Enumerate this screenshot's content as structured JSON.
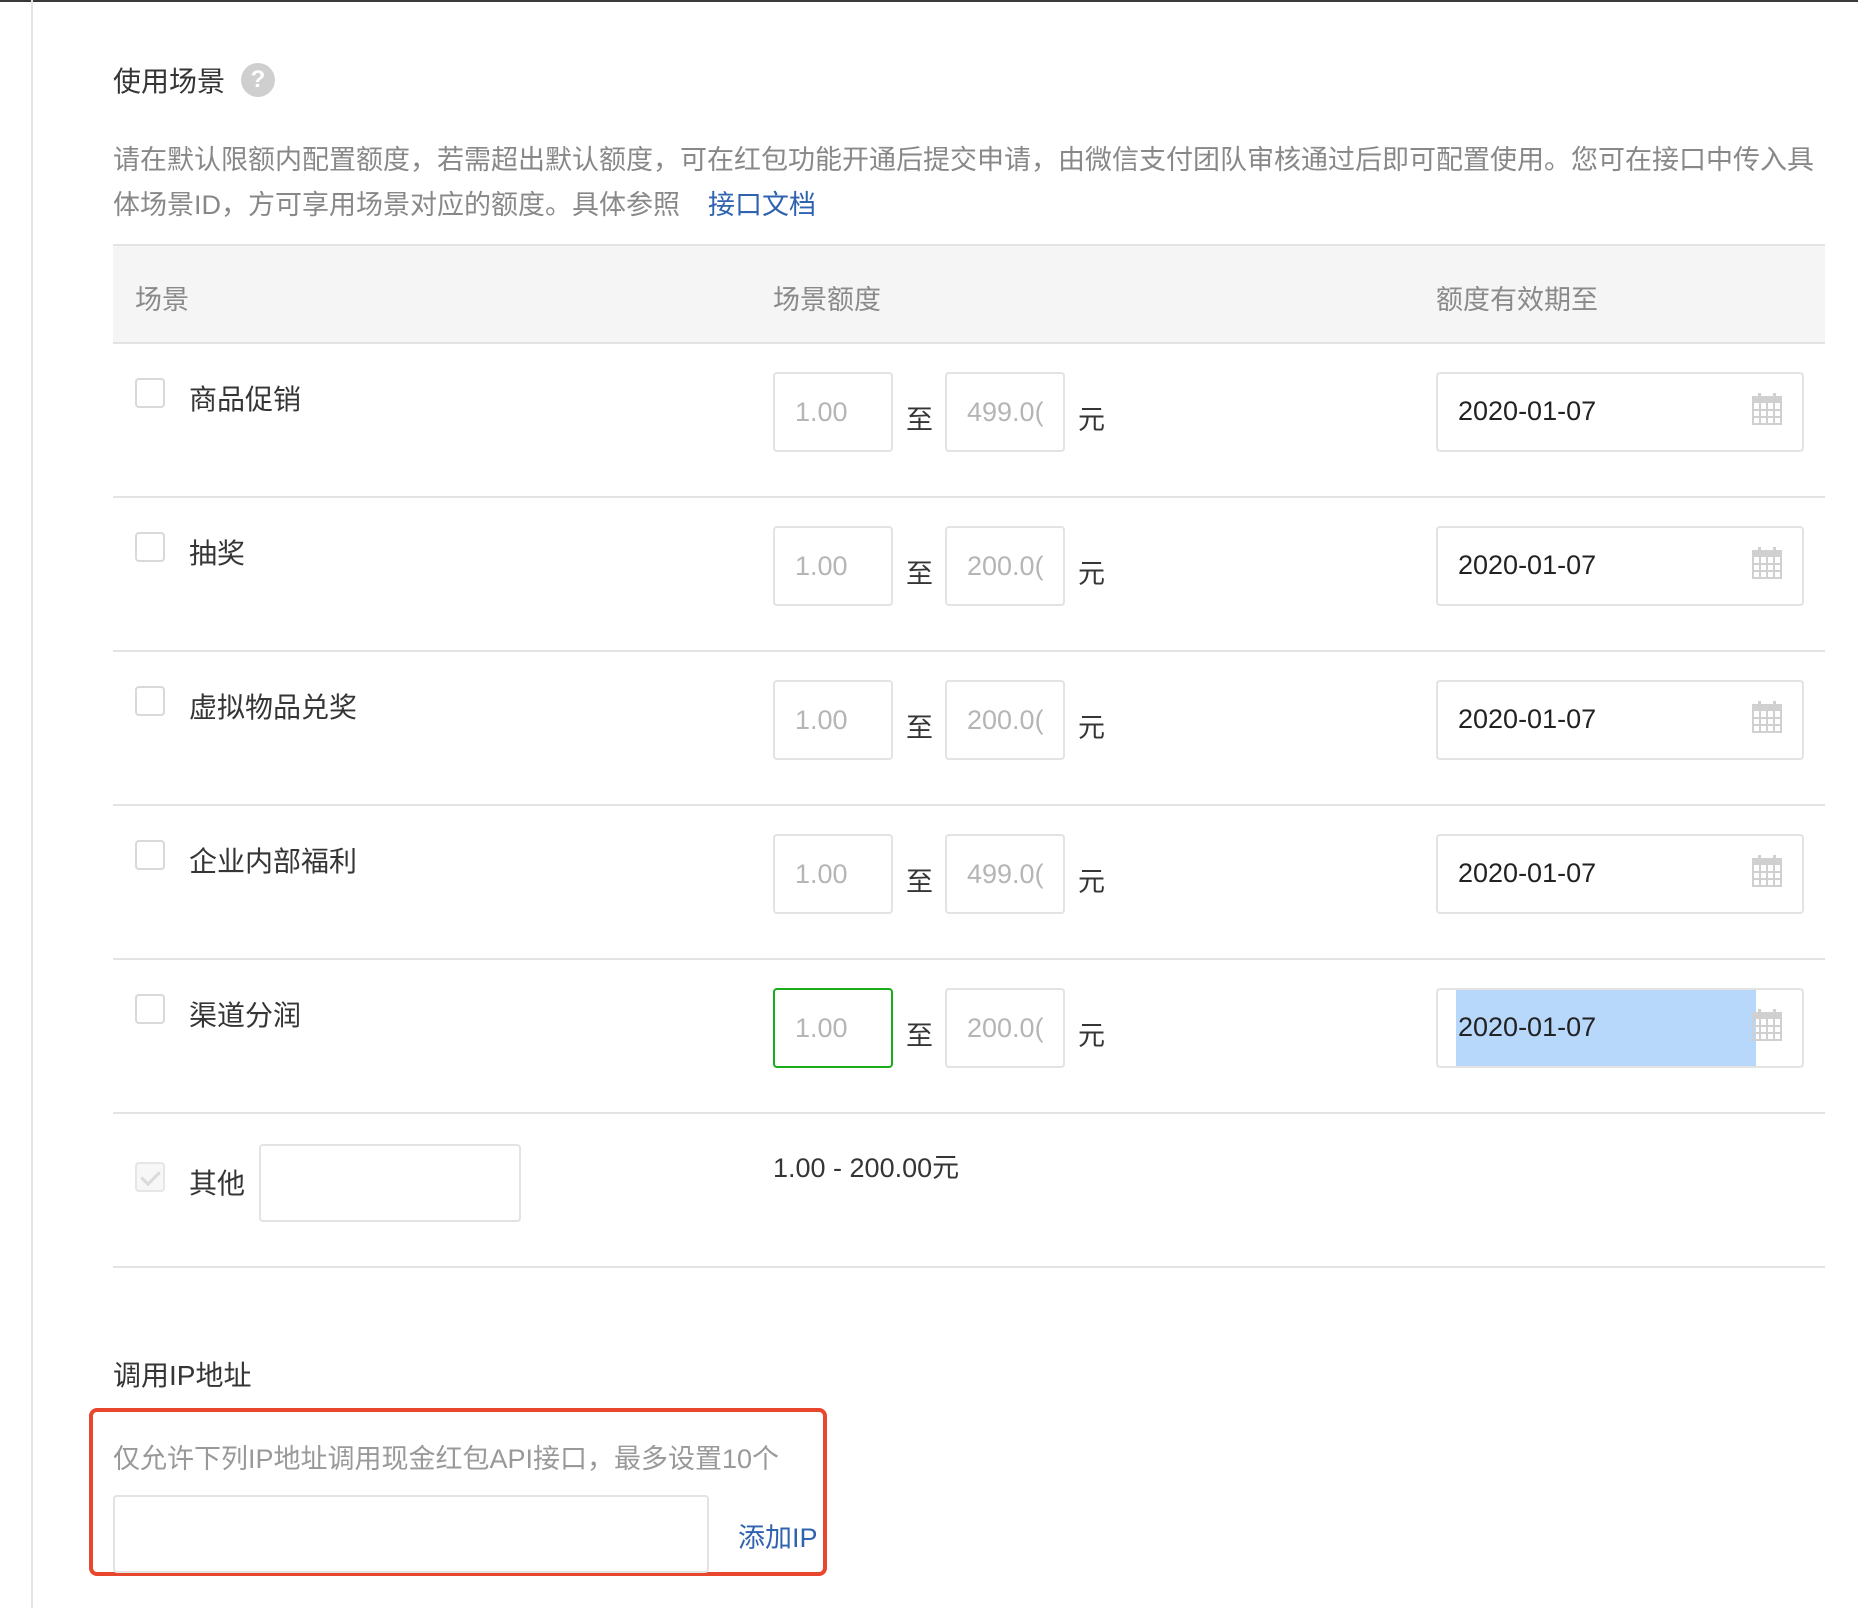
{
  "scene_section": {
    "title": "使用场景",
    "help_icon": "?",
    "description": "请在默认限额内配置额度，若需超出默认额度，可在红包功能开通后提交申请，由微信支付团队审核通过后即可配置使用。您可在接口中传入具体场景ID，方可享用场景对应的额度。具体参照",
    "doc_link": "接口文档"
  },
  "table": {
    "headers": {
      "scene": "场景",
      "amount": "场景额度",
      "valid_until": "额度有效期至"
    },
    "rows": [
      {
        "name": "商品促销",
        "min": "1.00",
        "max": "499.0(",
        "to": "至",
        "unit": "元",
        "date": "2020-01-07"
      },
      {
        "name": "抽奖",
        "min": "1.00",
        "max": "200.0(",
        "to": "至",
        "unit": "元",
        "date": "2020-01-07"
      },
      {
        "name": "虚拟物品兑奖",
        "min": "1.00",
        "max": "200.0(",
        "to": "至",
        "unit": "元",
        "date": "2020-01-07"
      },
      {
        "name": "企业内部福利",
        "min": "1.00",
        "max": "499.0(",
        "to": "至",
        "unit": "元",
        "date": "2020-01-07"
      },
      {
        "name": "渠道分润",
        "min": "1.00",
        "max": "200.0(",
        "to": "至",
        "unit": "元",
        "date": "2020-01-07"
      }
    ],
    "other": {
      "name": "其他",
      "input_value": "",
      "range": "1.00 - 200.00元"
    }
  },
  "ip_section": {
    "title": "调用IP地址",
    "description": "仅允许下列IP地址调用现金红包API接口，最多设置10个",
    "input_value": "",
    "add_link": "添加IP"
  },
  "colors": {
    "link": "#2f63b0",
    "focus_border": "#1aad19",
    "highlight_border": "#e8462d",
    "selection": "#b7d7fb"
  }
}
